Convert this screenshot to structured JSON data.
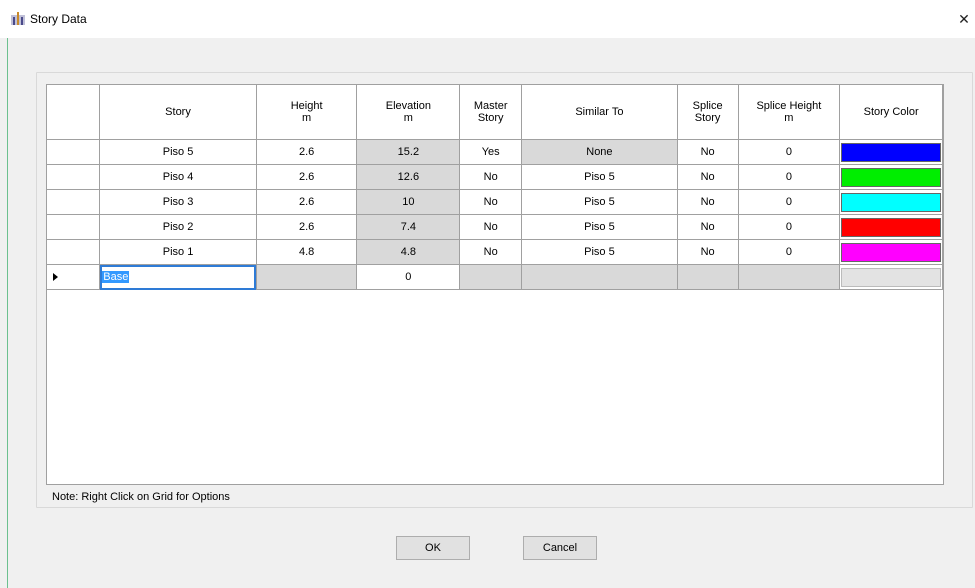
{
  "window": {
    "title": "Story Data",
    "close_label": "✕"
  },
  "grid": {
    "columns": [
      {
        "label": "",
        "unit": ""
      },
      {
        "label": "Story",
        "unit": ""
      },
      {
        "label": "Height",
        "unit": "m"
      },
      {
        "label": "Elevation",
        "unit": "m"
      },
      {
        "label": "Master\nStory",
        "unit": ""
      },
      {
        "label": "Similar To",
        "unit": ""
      },
      {
        "label": "Splice\nStory",
        "unit": ""
      },
      {
        "label": "Splice Height",
        "unit": "m"
      },
      {
        "label": "Story Color",
        "unit": ""
      }
    ],
    "rows": [
      {
        "story": "Piso 5",
        "height": "2.6",
        "elevation": "15.2",
        "master": "Yes",
        "similar": "None",
        "splice": "No",
        "splice_height": "0",
        "color": "#0000ff"
      },
      {
        "story": "Piso 4",
        "height": "2.6",
        "elevation": "12.6",
        "master": "No",
        "similar": "Piso 5",
        "splice": "No",
        "splice_height": "0",
        "color": "#00ee00"
      },
      {
        "story": "Piso 3",
        "height": "2.6",
        "elevation": "10",
        "master": "No",
        "similar": "Piso 5",
        "splice": "No",
        "splice_height": "0",
        "color": "#00ffff"
      },
      {
        "story": "Piso 2",
        "height": "2.6",
        "elevation": "7.4",
        "master": "No",
        "similar": "Piso 5",
        "splice": "No",
        "splice_height": "0",
        "color": "#ff0000"
      },
      {
        "story": "Piso 1",
        "height": "4.8",
        "elevation": "4.8",
        "master": "No",
        "similar": "Piso 5",
        "splice": "No",
        "splice_height": "0",
        "color": "#ff00ff"
      }
    ],
    "base_row": {
      "story": "Base",
      "elevation": "0"
    }
  },
  "note": "Note:  Right Click on Grid for Options",
  "buttons": {
    "ok": "OK",
    "cancel": "Cancel"
  }
}
